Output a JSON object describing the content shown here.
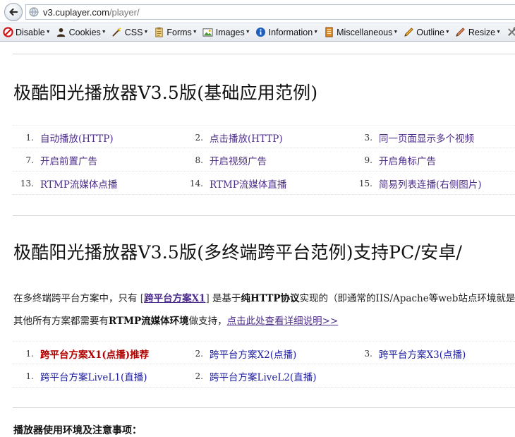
{
  "browser": {
    "url_host": "v3.cuplayer.com",
    "url_path": "/player/"
  },
  "toolbar": [
    {
      "label": "Disable",
      "icon": "disable-icon"
    },
    {
      "label": "Cookies",
      "icon": "cookies-icon"
    },
    {
      "label": "CSS",
      "icon": "css-icon"
    },
    {
      "label": "Forms",
      "icon": "forms-icon"
    },
    {
      "label": "Images",
      "icon": "images-icon"
    },
    {
      "label": "Information",
      "icon": "information-icon"
    },
    {
      "label": "Miscellaneous",
      "icon": "miscellaneous-icon"
    },
    {
      "label": "Outline",
      "icon": "outline-icon"
    },
    {
      "label": "Resize",
      "icon": "resize-icon"
    },
    {
      "label": "T",
      "icon": "tools-icon"
    }
  ],
  "section1": {
    "title": "极酷阳光播放器V3.5版(基础应用范例)",
    "rows": [
      [
        {
          "num": "1.",
          "label": "自动播放(HTTP)"
        },
        {
          "num": "2.",
          "label": "点击播放(HTTP)"
        },
        {
          "num": "3.",
          "label": "同一页面显示多个视频"
        }
      ],
      [
        {
          "num": "7.",
          "label": "开启前置广告"
        },
        {
          "num": "8.",
          "label": "开启视频广告"
        },
        {
          "num": "9.",
          "label": "开启角标广告"
        }
      ],
      [
        {
          "num": "13.",
          "label": "RTMP流媒体点播"
        },
        {
          "num": "14.",
          "label": "RTMP流媒体直播"
        },
        {
          "num": "15.",
          "label": "简易列表连播(右侧图片)"
        }
      ]
    ]
  },
  "section2": {
    "title": "极酷阳光播放器V3.5版(多终端跨平台范例)支持PC/安卓/",
    "para1": {
      "prefix": "在多终端跨平台方案中，只有",
      "bracket_open": "[",
      "link": "跨平台方案X1",
      "bracket_close": "]",
      "mid": "是基于",
      "bold": "纯HTTP协议",
      "suffix": "实现的（即通常的IIS/Apache等web站点环境就是"
    },
    "para2": {
      "prefix": "其他所有方案都需要有",
      "bold": "RTMP流媒体环境",
      "mid": "做支持，",
      "link": "点击此处查看详细说明>>"
    },
    "rows": [
      [
        {
          "num": "1.",
          "label": "跨平台方案X1(点播)推荐"
        },
        {
          "num": "2.",
          "label": "跨平台方案X2(点播)"
        },
        {
          "num": "3.",
          "label": "跨平台方案X3(点播)"
        }
      ],
      [
        {
          "num": "1.",
          "label": "跨平台方案LiveL1(直播)"
        },
        {
          "num": "2.",
          "label": "跨平台方案LiveL2(直播)"
        }
      ]
    ]
  },
  "section3": {
    "title": "播放器使用环境及注意事项："
  }
}
